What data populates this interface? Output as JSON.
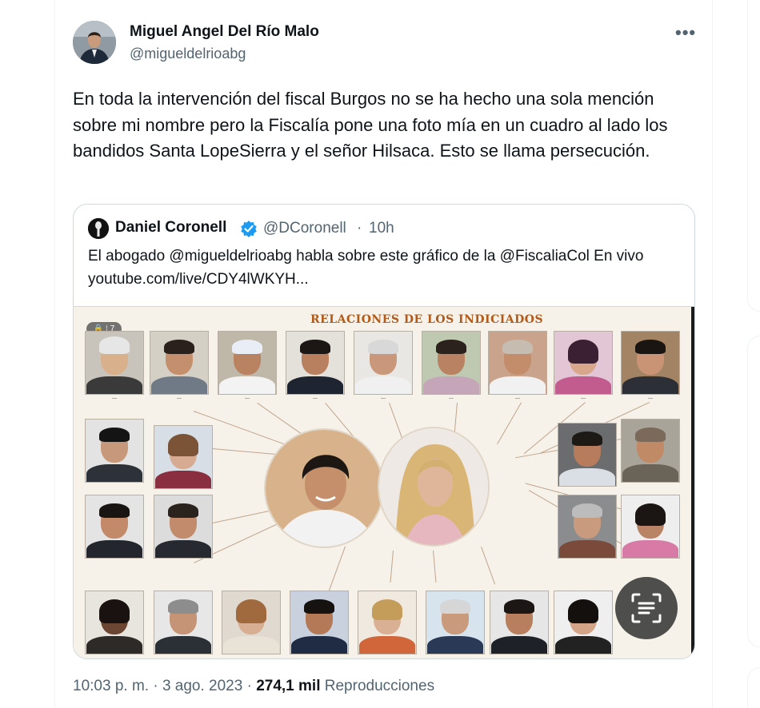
{
  "tweet": {
    "author_name": "Miguel Angel Del Río Malo",
    "author_handle": "@migueldelrioabg",
    "more_icon": "more-horizontal-icon",
    "text": "En toda la intervención del fiscal Burgos no se ha hecho una sola mención sobre mi nombre pero la Fiscalía pone una foto mía en un cuadro al lado los bandidos Santa LopeSierra y el señor Hilsaca. Esto se llama persecución.",
    "quoted": {
      "author_name": "Daniel Coronell",
      "verified_icon": "verified-badge-icon",
      "author_handle": "@DCoronell",
      "separator": "·",
      "time": "10h",
      "text": "El abogado @migueldelrioabg habla sobre este gráfico de la @FiscaliaCol En vivo youtube.com/live/CDY4lWKYH...",
      "media": {
        "title": "RELACIONES DE LOS INDICIADOS",
        "lock_chip": "🔒 ⁝ 7",
        "scan_icon": "text-scan-icon"
      }
    },
    "timestamp": "10:03 p. m. · 3 ago. 2023 · ",
    "views_count": "274,1 mil",
    "views_label": " Reproducciones"
  },
  "colors": {
    "text_primary": "#0f1419",
    "text_secondary": "#536471",
    "border": "#cfd9de",
    "verified": "#1d9bf0",
    "chart_title": "#b15a19"
  }
}
